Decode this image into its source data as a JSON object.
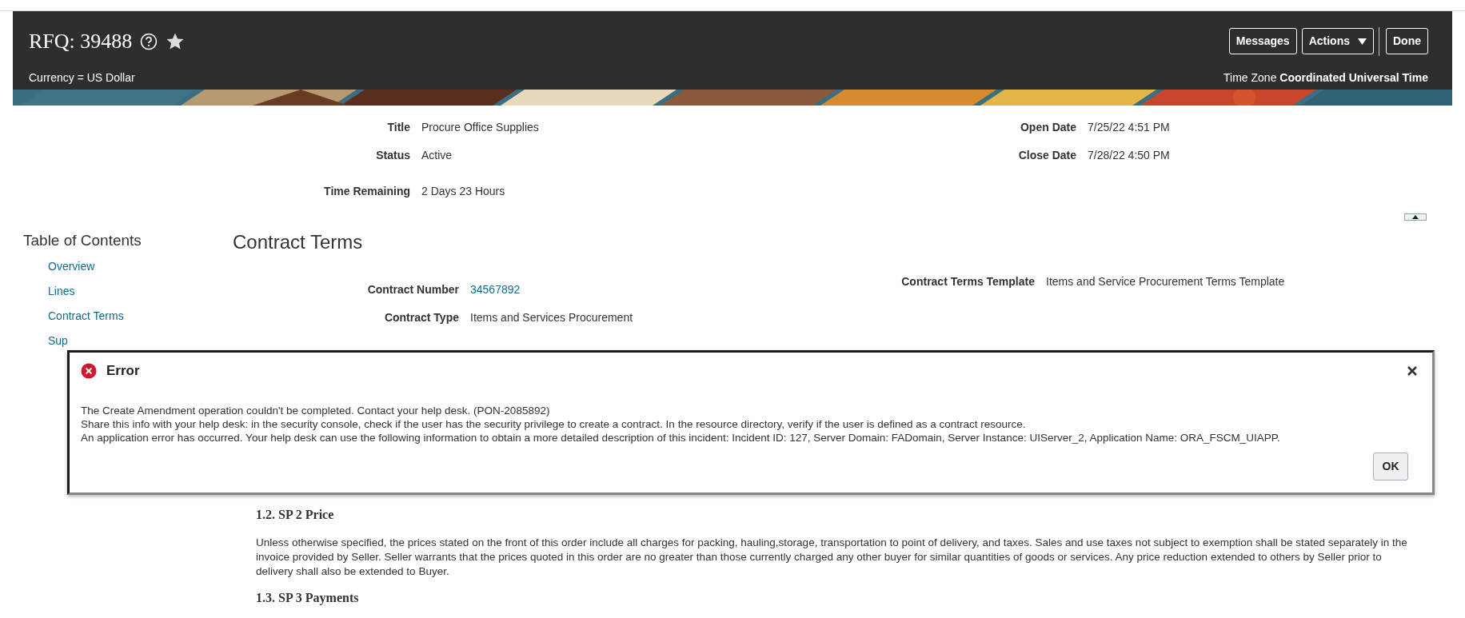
{
  "header": {
    "title": "RFQ: 39488",
    "buttons": [
      {
        "label": "Messages",
        "kind": "plain"
      },
      {
        "label": "Actions",
        "kind": "menu"
      },
      {
        "label": "Done",
        "kind": "separated"
      }
    ],
    "currency": "Currency = US Dollar",
    "time_zone_label": "Time Zone",
    "time_zone_value": "Coordinated Universal Time"
  },
  "summary": {
    "left": [
      {
        "label": "Title",
        "value": "Procure Office Supplies"
      },
      {
        "label": "Status",
        "value": "Active"
      },
      {
        "label": "Time Remaining",
        "value": "2 Days 23 Hours"
      }
    ],
    "right": [
      {
        "label": "Open Date",
        "value": "7/25/22 4:51 PM"
      },
      {
        "label": "Close Date",
        "value": "7/28/22 4:50 PM"
      }
    ]
  },
  "toc": {
    "title": "Table of Contents",
    "items": [
      "Overview",
      "Lines",
      "Contract Terms",
      "Sup"
    ]
  },
  "section": {
    "title": "Contract Terms",
    "left": [
      {
        "label": "Contract Number",
        "value": "34567892",
        "kind": "link"
      },
      {
        "label": "Contract Type",
        "value": "Items and Services Procurement",
        "kind": "text"
      }
    ],
    "right": [
      {
        "label": "Contract Terms Template",
        "value": "Items and Service Procurement Terms Template"
      }
    ]
  },
  "dialog": {
    "title": "Error",
    "lines": [
      "The Create Amendment operation couldn't be completed. Contact your help desk. (PON-2085892)",
      "Share this info with your help desk: in the security console, check if the user has the security privilege to create a contract. In the resource directory, verify if the user is defined as a contract resource.",
      "An application error has occurred. Your help desk can use the following information to obtain a more detailed description of this incident: Incident ID: 127, Server Domain: FADomain, Server Instance: UIServer_2, Application Name: ORA_FSCM_UIAPP."
    ],
    "ok": "OK"
  },
  "clauses": [
    {
      "heading": "1.2. SP 2 Price",
      "body": "Unless otherwise specified, the prices stated on the front of this order include all charges for packing, hauling,storage, transportation to point of delivery, and taxes. Sales and use taxes not subject to exemption shall be stated separately in the invoice provided by Seller. Seller warrants that the prices quoted in this order are no greater than those currently charged any other buyer for similar quantities of goods or services. Any price reduction extended to others by Seller prior to delivery shall also be extended to Buyer."
    },
    {
      "heading": "1.3. SP 3 Payments"
    }
  ]
}
